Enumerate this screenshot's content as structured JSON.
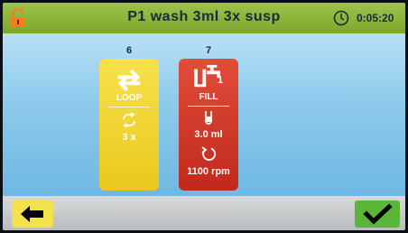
{
  "header": {
    "title": "P1 wash 3ml 3x susp",
    "timer": "0:05:20",
    "lock_icon": "lock-open-icon",
    "timer_icon": "clock-icon"
  },
  "steps": [
    {
      "number": "6",
      "label": "LOOP",
      "value": "3 x",
      "color": "#eccf22",
      "icon": "loop-icon",
      "sub_icon": "repeat-icon"
    },
    {
      "number": "7",
      "label": "FILL",
      "tap_index": "1",
      "volume": "3.0 ml",
      "speed": "1100 rpm",
      "color": "#cf3a2a",
      "icon": "tap-tube-icon",
      "sub_icons": [
        "tube-icon",
        "rotate-icon"
      ]
    }
  ],
  "footer": {
    "back_icon": "arrow-left-icon",
    "confirm_icon": "checkmark-icon",
    "back_color": "#f2e14a",
    "confirm_color": "#5bb538"
  }
}
